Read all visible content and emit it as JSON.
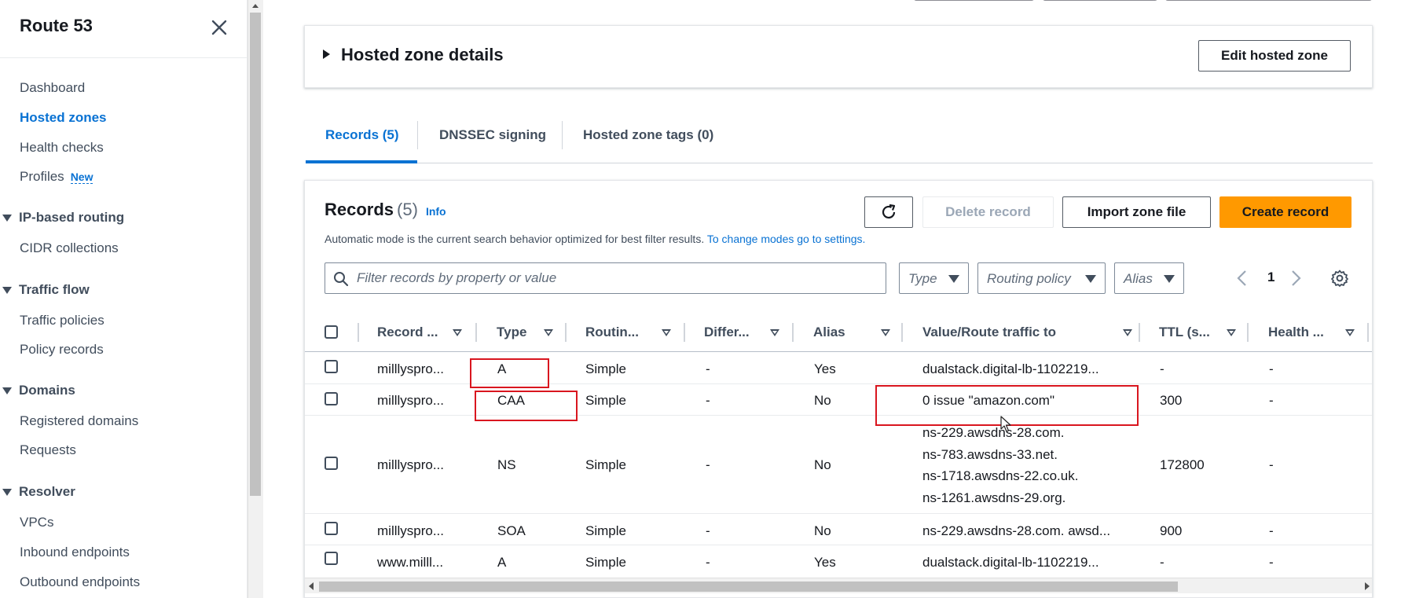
{
  "sidebar": {
    "title": "Route 53",
    "items": {
      "dashboard": "Dashboard",
      "hosted_zones": "Hosted zones",
      "health_checks": "Health checks",
      "profiles": "Profiles",
      "profiles_badge": "New",
      "cidr_collections": "CIDR collections",
      "traffic_policies": "Traffic policies",
      "policy_records": "Policy records",
      "registered_domains": "Registered domains",
      "requests": "Requests",
      "vpcs": "VPCs",
      "inbound_endpoints": "Inbound endpoints",
      "outbound_endpoints": "Outbound endpoints"
    },
    "groups": {
      "ip_routing": "IP-based routing",
      "traffic_flow": "Traffic flow",
      "domains": "Domains",
      "resolver": "Resolver"
    },
    "active_item": "Hosted zones"
  },
  "details": {
    "title": "Hosted zone details",
    "edit_button": "Edit hosted zone"
  },
  "tabs": [
    {
      "label": "Records (5)",
      "active": true
    },
    {
      "label": "DNSSEC signing",
      "active": false
    },
    {
      "label": "Hosted zone tags (0)",
      "active": false
    }
  ],
  "records": {
    "title": "Records",
    "count": "(5)",
    "info": "Info",
    "description": "Automatic mode is the current search behavior optimized for best filter results.",
    "description_link": "To change modes go to settings.",
    "delete_button": "Delete record",
    "import_button": "Import zone file",
    "create_button": "Create record",
    "search_placeholder": "Filter records by property or value",
    "filters": {
      "type": "Type",
      "routing_policy": "Routing policy",
      "alias": "Alias"
    },
    "page": "1",
    "columns": {
      "record_name": "Record ...",
      "type": "Type",
      "routing": "Routin...",
      "differentiator": "Differ...",
      "alias": "Alias",
      "value": "Value/Route traffic to",
      "ttl": "TTL (s...",
      "health": "Health ..."
    },
    "rows": [
      {
        "name": "milllyspro...",
        "type": "A",
        "routing": "Simple",
        "diff": "-",
        "alias": "Yes",
        "value": "dualstack.digital-lb-1102219...",
        "ttl": "-",
        "health": "-"
      },
      {
        "name": "milllyspro...",
        "type": "CAA",
        "routing": "Simple",
        "diff": "-",
        "alias": "No",
        "value": "0 issue \"amazon.com\"",
        "ttl": "300",
        "health": "-"
      },
      {
        "name": "milllyspro...",
        "type": "NS",
        "routing": "Simple",
        "diff": "-",
        "alias": "No",
        "value_lines": [
          "ns-229.awsdns-28.com.",
          "ns-783.awsdns-33.net.",
          "ns-1718.awsdns-22.co.uk.",
          "ns-1261.awsdns-29.org."
        ],
        "ttl": "172800",
        "health": "-"
      },
      {
        "name": "milllyspro...",
        "type": "SOA",
        "routing": "Simple",
        "diff": "-",
        "alias": "No",
        "value": "ns-229.awsdns-28.com. awsd...",
        "ttl": "900",
        "health": "-"
      },
      {
        "name": "www.milll...",
        "type": "A",
        "routing": "Simple",
        "diff": "-",
        "alias": "Yes",
        "value": "dualstack.digital-lb-1102219...",
        "ttl": "-",
        "health": "-"
      }
    ]
  },
  "colors": {
    "accent": "#0972d3",
    "primary_button": "#ff9900",
    "highlight_box": "#d9161f"
  }
}
